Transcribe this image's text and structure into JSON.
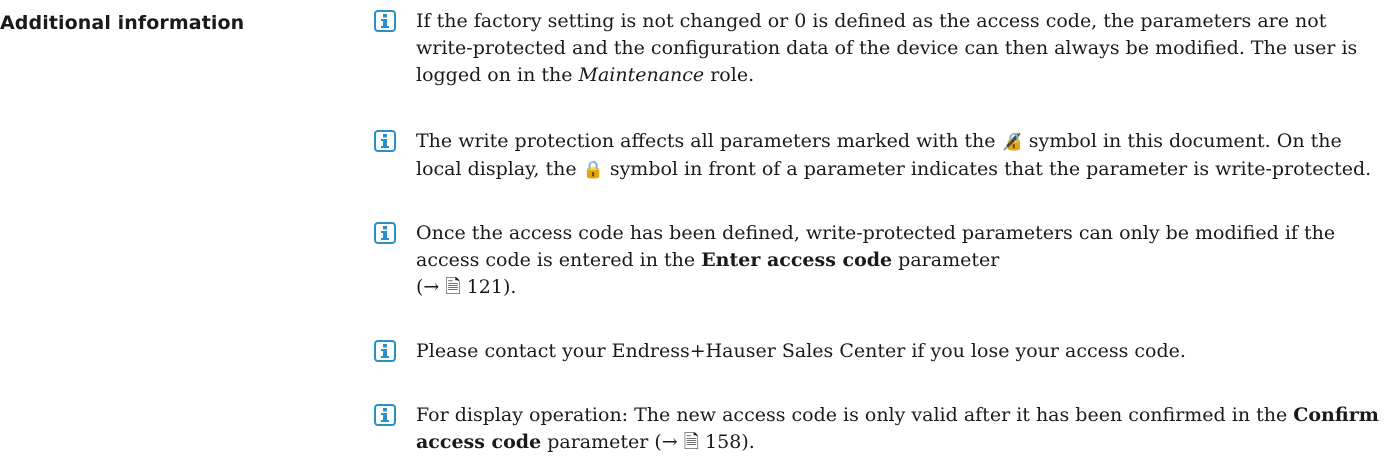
{
  "section_label": "Additional information",
  "notes": [
    {
      "parts": [
        {
          "t": "If the factory setting is not changed or 0 is defined as the access code, the parameters are not write-protected and the configuration data of the device can then always be modified. The user is logged on in the "
        },
        {
          "t": "Maintenance",
          "style": "italic"
        },
        {
          "t": " role."
        }
      ]
    },
    {
      "parts": [
        {
          "t": "The write protection affects all parameters marked with the "
        },
        {
          "t": "🔏",
          "style": "symbol",
          "icon": "lock-box-icon"
        },
        {
          "t": " symbol in this document. On the local display, the "
        },
        {
          "t": "🔒",
          "style": "symbol",
          "icon": "lock-icon"
        },
        {
          "t": " symbol in front of a parameter indicates that the parameter is write-protected."
        }
      ]
    },
    {
      "parts": [
        {
          "t": "Once the access code has been defined, write-protected parameters can only be modified if the access code is entered in the "
        },
        {
          "t": "Enter access code",
          "style": "bold"
        },
        {
          "t": " parameter"
        },
        {
          "t": "(→ 🗎 121).",
          "style": "ref"
        }
      ]
    },
    {
      "parts": [
        {
          "t": "Please contact your Endress+Hauser Sales Center if you lose your access code."
        }
      ]
    },
    {
      "parts": [
        {
          "t": "For display operation: The new access code is only valid after it has been confirmed in the "
        },
        {
          "t": "Confirm access code",
          "style": "bold"
        },
        {
          "t": " parameter (→ 🗎 158)."
        }
      ]
    }
  ],
  "icon": {
    "name": "info-icon",
    "color": "#2a8fc4"
  }
}
